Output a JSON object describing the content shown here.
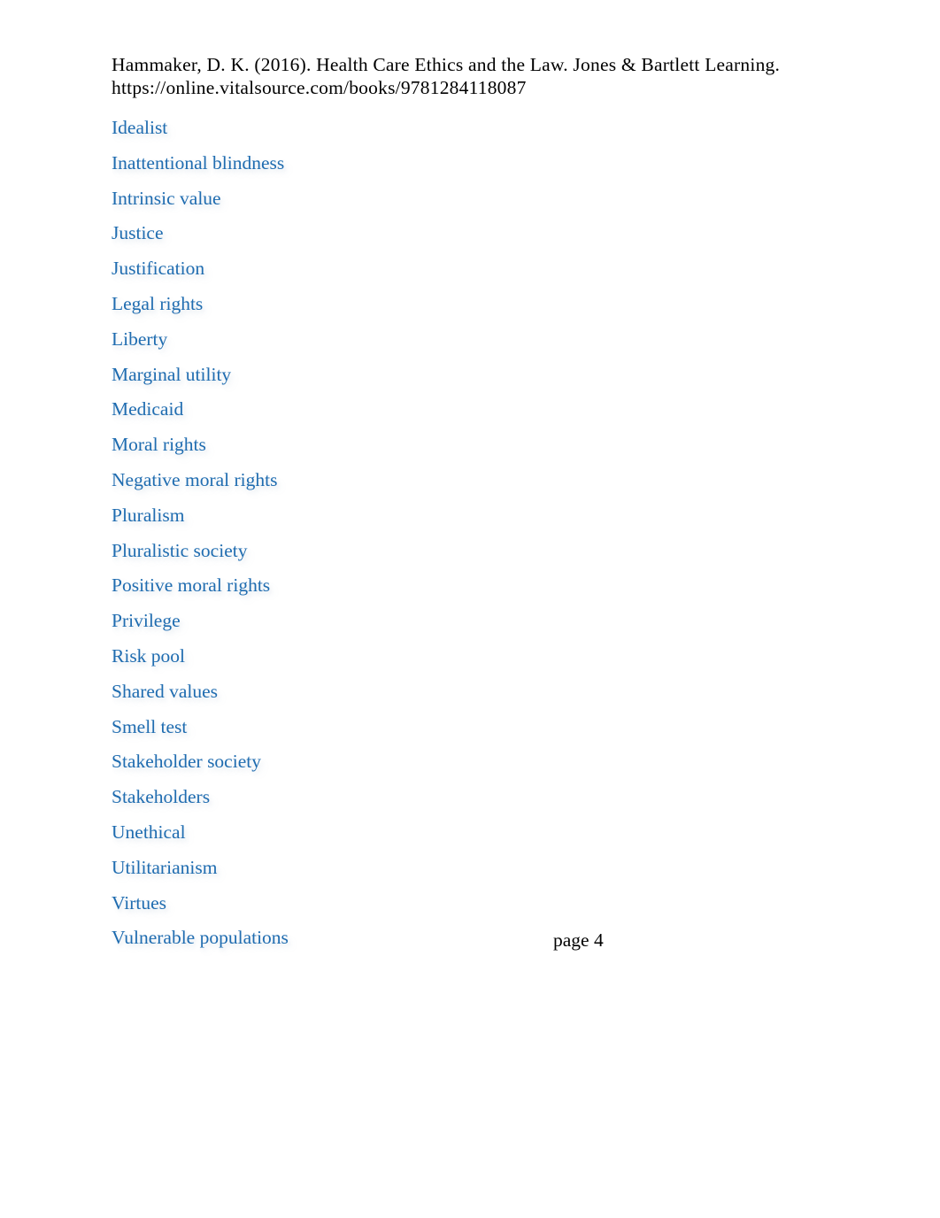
{
  "document": {
    "background_color": "#ffffff",
    "text_color": "#000000",
    "link_color": "#1f6cb0"
  },
  "citation": {
    "line1": "Hammaker, D. K. (2016). Health Care Ethics and the Law. Jones & Bartlett Learning.",
    "line2": "https://online.vitalsource.com/books/9781284118087"
  },
  "glossary": {
    "terms": [
      "Idealist",
      "Inattentional blindness",
      "Intrinsic value",
      "Justice",
      "Justification",
      "Legal rights",
      "Liberty",
      "Marginal utility",
      "Medicaid",
      "Moral rights",
      "Negative moral rights",
      "Pluralism",
      "Pluralistic society",
      "Positive moral rights",
      "Privilege",
      "Risk pool",
      "Shared values",
      "Smell test",
      "Stakeholder society",
      "Stakeholders",
      "Unethical",
      "Utilitarianism",
      "Virtues",
      "Vulnerable populations"
    ]
  },
  "footer": {
    "page_marker": "page 4"
  }
}
